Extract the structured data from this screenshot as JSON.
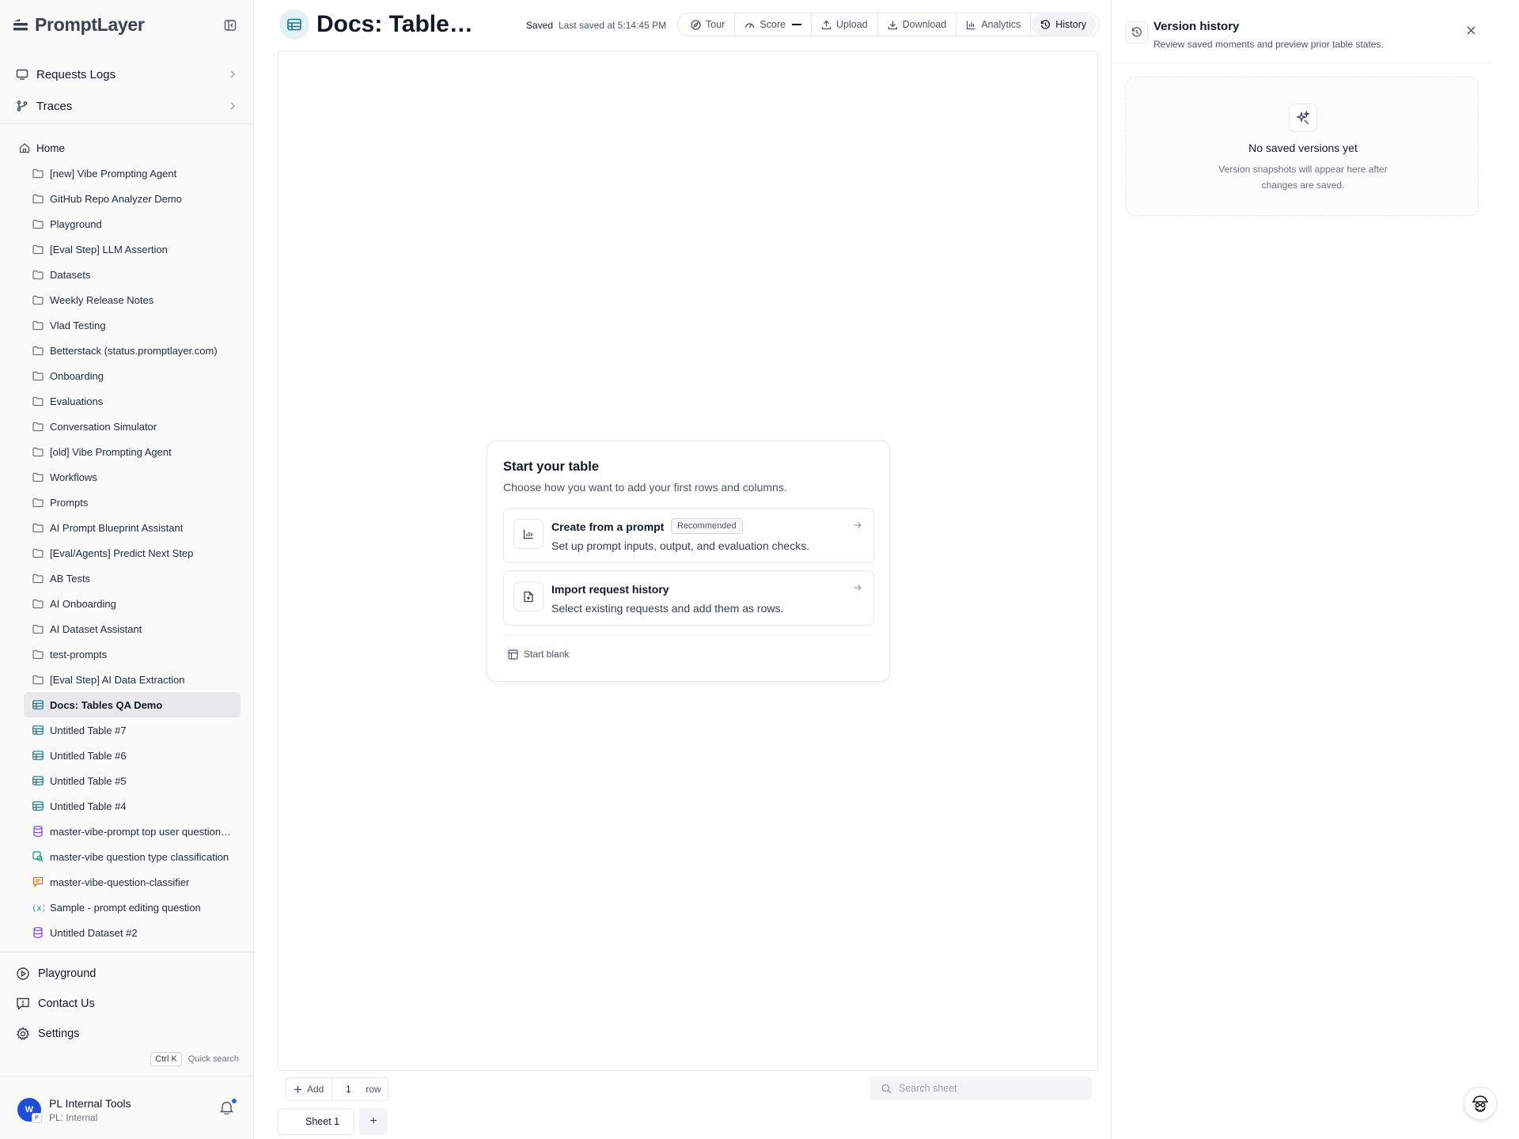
{
  "brand": {
    "name": "PromptLayer"
  },
  "sidebar": {
    "nav_top": [
      {
        "label": "Requests Logs",
        "icon": "monitor-icon"
      },
      {
        "label": "Traces",
        "icon": "branch-icon"
      }
    ],
    "home_label": "Home",
    "tree": [
      {
        "label": "[new] Vibe Prompting Agent",
        "icon": "folder-icon"
      },
      {
        "label": "GitHub Repo Analyzer Demo",
        "icon": "folder-icon"
      },
      {
        "label": "Playground",
        "icon": "folder-icon"
      },
      {
        "label": "[Eval Step] LLM Assertion",
        "icon": "folder-icon"
      },
      {
        "label": "Datasets",
        "icon": "folder-icon"
      },
      {
        "label": "Weekly Release Notes",
        "icon": "folder-icon"
      },
      {
        "label": "Vlad Testing",
        "icon": "folder-icon"
      },
      {
        "label": "Betterstack (status.promptlayer.com)",
        "icon": "folder-icon"
      },
      {
        "label": "Onboarding",
        "icon": "folder-icon"
      },
      {
        "label": "Evaluations",
        "icon": "folder-icon"
      },
      {
        "label": "Conversation Simulator",
        "icon": "folder-icon"
      },
      {
        "label": "[old] Vibe Prompting Agent",
        "icon": "folder-icon"
      },
      {
        "label": "Workflows",
        "icon": "folder-icon"
      },
      {
        "label": "Prompts",
        "icon": "folder-icon"
      },
      {
        "label": "AI Prompt Blueprint Assistant",
        "icon": "folder-icon"
      },
      {
        "label": "[Eval/Agents] Predict Next Step",
        "icon": "folder-icon"
      },
      {
        "label": "AB Tests",
        "icon": "folder-icon"
      },
      {
        "label": "AI Onboarding",
        "icon": "folder-icon"
      },
      {
        "label": "AI Dataset Assistant",
        "icon": "folder-icon"
      },
      {
        "label": "test-prompts",
        "icon": "folder-icon"
      },
      {
        "label": "[Eval Step] AI Data Extraction",
        "icon": "folder-icon"
      },
      {
        "label": "Docs: Tables QA Demo",
        "icon": "table-icon",
        "active": true
      },
      {
        "label": "Untitled Table #7",
        "icon": "table-icon"
      },
      {
        "label": "Untitled Table #6",
        "icon": "table-icon"
      },
      {
        "label": "Untitled Table #5",
        "icon": "table-icon"
      },
      {
        "label": "Untitled Table #4",
        "icon": "table-icon"
      },
      {
        "label": "master-vibe-prompt top user question…",
        "icon": "dataset-icon"
      },
      {
        "label": "master-vibe question type classification",
        "icon": "search-eval-icon"
      },
      {
        "label": "master-vibe-question-classifier",
        "icon": "chat-prompt-icon"
      },
      {
        "label": "Sample - prompt editing question",
        "icon": "variable-icon"
      },
      {
        "label": "Untitled Dataset #2",
        "icon": "dataset-icon"
      }
    ],
    "nav_bottom": [
      {
        "label": "Playground",
        "icon": "play-circle-icon"
      },
      {
        "label": "Contact Us",
        "icon": "message-alert-icon"
      },
      {
        "label": "Settings",
        "icon": "gear-icon"
      }
    ],
    "quick_search": {
      "keys": "Ctrl K",
      "label": "Quick search"
    },
    "user": {
      "avatar_letter": "W",
      "avatar_sub": "P",
      "org": "PL Internal Tools",
      "sub": "PL: Internal"
    }
  },
  "header": {
    "title": "Docs: Table…",
    "saved": "Saved",
    "last_saved": "Last saved at 5:14:45 PM",
    "toolbar": {
      "tour": "Tour",
      "score": "Score",
      "upload": "Upload",
      "download": "Download",
      "analytics": "Analytics",
      "history": "History"
    }
  },
  "start_card": {
    "title": "Start your table",
    "subtitle": "Choose how you want to add your first rows and columns.",
    "options": [
      {
        "title": "Create from a prompt",
        "badge": "Recommended",
        "desc": "Set up prompt inputs, output, and evaluation checks."
      },
      {
        "title": "Import request history",
        "desc": "Select existing requests and add them as rows."
      }
    ],
    "start_blank": "Start blank"
  },
  "bottom": {
    "add_label": "Add",
    "row_count": "1",
    "row_label": "row",
    "search_placeholder": "Search sheet",
    "sheet_tab": "Sheet 1",
    "add_sheet": "+"
  },
  "version_history": {
    "title": "Version history",
    "subtitle": "Review saved moments and preview prior table states.",
    "empty_title": "No saved versions yet",
    "empty_desc": "Version snapshots will appear here after changes are saved."
  }
}
